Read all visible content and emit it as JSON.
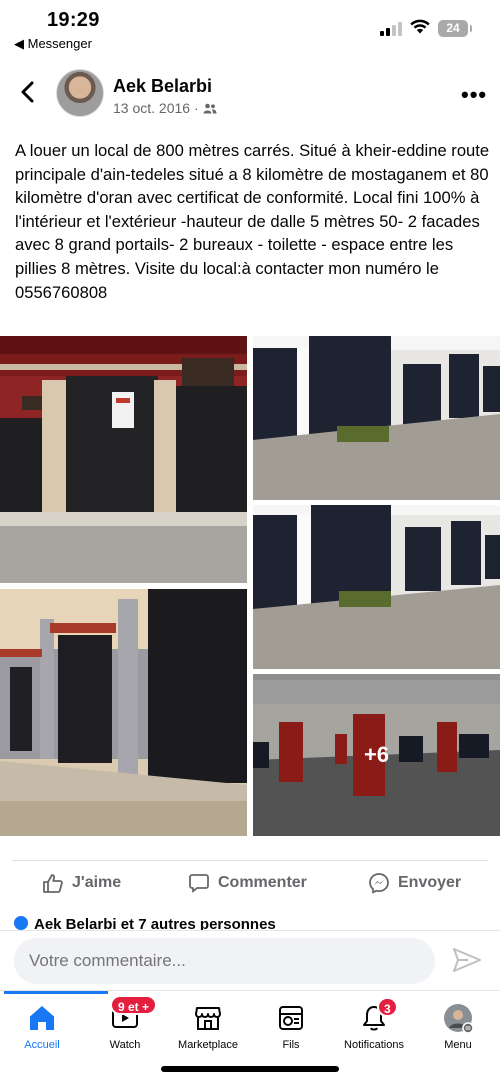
{
  "status_bar": {
    "time": "19:29",
    "back_app": "◀ Messenger",
    "battery": "24"
  },
  "post": {
    "author": "Aek Belarbi",
    "date": "13 oct. 2016 ·",
    "audience_icon": "friends-icon",
    "text": "A louer un local de 800 mètres carrés. Situé à kheir-eddine route principale d'ain-tedeles situé  a 8 kilomètre  de mostaganem et 80 kilomètre d'oran avec certificat  de conformité. Local fini 100% à l'intérieur et l'extérieur -hauteur de dalle 5 mètres 50- 2 facades avec 8 grand portails- 2 bureaux - toilette - espace entre les pillies 8 mètres. Visite du local:à contacter mon numéro  le 0556760808",
    "more_photos": "+6"
  },
  "actions": {
    "like": "J'aime",
    "comment": "Commenter",
    "send": "Envoyer"
  },
  "reactions_text": "Aek Belarbi et 7 autres personnes",
  "comment_placeholder": "Votre commentaire...",
  "nav": {
    "items": [
      {
        "label": "Accueil",
        "icon": "home-icon"
      },
      {
        "label": "Watch",
        "icon": "watch-icon",
        "badge": "9 et +"
      },
      {
        "label": "Marketplace",
        "icon": "marketplace-icon"
      },
      {
        "label": "Fils",
        "icon": "feeds-icon"
      },
      {
        "label": "Notifications",
        "icon": "bell-icon",
        "badge": "3"
      },
      {
        "label": "Menu",
        "icon": "menu-avatar-icon"
      }
    ]
  },
  "colors": {
    "accent": "#1877f2",
    "badge": "#e41e3f",
    "secondary_text": "#65676b"
  }
}
